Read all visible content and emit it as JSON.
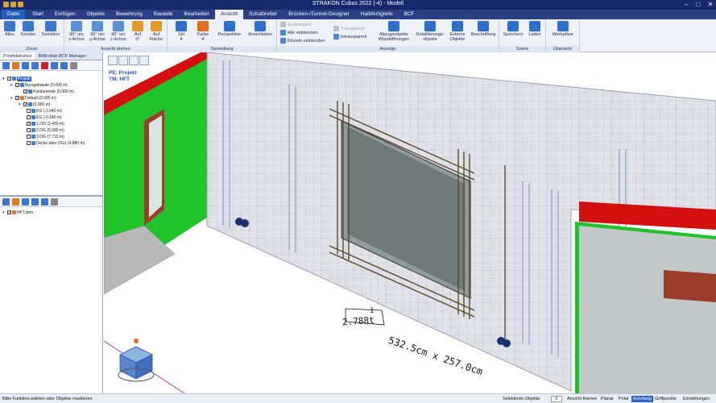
{
  "window": {
    "title": "STRAKON Cubus 2022 (-4) - Modell",
    "minimize": "–",
    "maximize": "□",
    "close": "✕"
  },
  "tabs": [
    "Datei",
    "Start",
    "Einfügen",
    "Objekte",
    "Bewehrung",
    "Bauteile",
    "Bearbeiten",
    "Ansicht",
    "Schalbretter",
    "Brücken-/Tunnel-Designer",
    "Halbfertigteile",
    "BCF"
  ],
  "ribbon": {
    "zoom": {
      "label": "Zoom",
      "buttons": [
        "Alles",
        "Fenster",
        "Selektion"
      ]
    },
    "ansicht_drehen": {
      "label": "Ansicht drehen",
      "buttons": [
        {
          "line1": "90° um",
          "line2": "x-Achse"
        },
        {
          "line1": "90° um",
          "line2": "y-Achse"
        },
        {
          "line1": "90° um",
          "line2": "z-Achse"
        },
        {
          "line1": "Auf",
          "line2": "0°"
        },
        {
          "line1": "Auf",
          "line2": "Fläche"
        }
      ]
    },
    "darstellung": {
      "label": "Darstellung",
      "buttons": [
        "Stil",
        "Farbe",
        "Perspektive",
        "Ansichtsbox"
      ]
    },
    "anzeige": {
      "label": "Anzeige",
      "small": [
        "Ausblenden",
        "Alle einblenden",
        "Einzeln einblenden",
        "Transparent",
        "Intransparent"
      ],
      "buttons": [
        {
          "line1": "Abzugsobjekte",
          "line2": "Wandöffnungen"
        },
        {
          "line1": "Detaillierungs-",
          "line2": "objekte"
        },
        {
          "line1": "Externe",
          "line2": "Objekte"
        },
        {
          "line1": "Beschriftung",
          "line2": ""
        }
      ]
    },
    "szene": {
      "label": "Szene",
      "buttons": [
        "Speichern",
        "Laden"
      ]
    },
    "uebersicht": {
      "label": "Übersicht",
      "buttons": [
        "Werkpläne"
      ]
    }
  },
  "left_panel": {
    "tabs": [
      "Projektstruktur",
      "BIMcollab BCF Manager"
    ],
    "tree": [
      {
        "label": "Projekt",
        "level": 0
      },
      {
        "label": "Burogebäude (0.000 m)",
        "level": 1
      },
      {
        "label": "Fundamente (0.000 m)",
        "level": 2
      },
      {
        "label": "Default (0.000 m)",
        "level": 1
      },
      {
        "label": "(0.000 m)",
        "level": 2
      },
      {
        "label": "KG (-2.940 m)",
        "level": 3
      },
      {
        "label": "EG (-0.180 m)",
        "level": 3
      },
      {
        "label": "1.OG (2.450 m)",
        "level": 3
      },
      {
        "label": "2.OG (5.080 m)",
        "level": 3
      },
      {
        "label": "3.OG (7.710 m)",
        "level": 3
      },
      {
        "label": "Decke über OG1 (4.880 m)",
        "level": 3
      }
    ],
    "files": [
      {
        "label": "HFT.sbm"
      }
    ]
  },
  "viewport": {
    "info_line1": "PE: Projekt",
    "info_line2": "TM: HFT",
    "annotation_count": "1",
    "annotation_weight": "2.788t",
    "annotation_dims": "532.5cm x 257.0cm"
  },
  "statusbar": {
    "message": "Bitte Funktion wählen oder Objekte markieren",
    "selected_label": "Selektierte Objekte",
    "selected_count": "0",
    "items": [
      "Ansicht fixieren",
      "Planar",
      "Polar",
      "Achsfang",
      "Griffpunkte",
      "Einstellungen"
    ],
    "active_item": "Achsfang"
  },
  "colors": {
    "titlebar": "#15296b",
    "tabs": "#2b3f84",
    "ribbon": "#eef2f8",
    "wall_green": "#1fc32a",
    "wall_red": "#d21010",
    "rebar": "#5a4a2a",
    "mesh": "#3d4fa8",
    "selection": "#2a62c9"
  }
}
